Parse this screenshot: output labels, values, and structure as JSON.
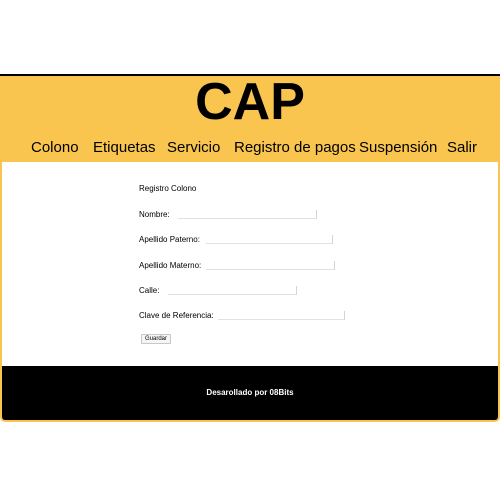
{
  "header": {
    "logo": "CAP",
    "background_color": "#f9c54f"
  },
  "nav": {
    "items": [
      {
        "label": "Colono"
      },
      {
        "label": "Etiquetas"
      },
      {
        "label": "Servicio"
      },
      {
        "label": "Registro de pagos"
      },
      {
        "label": "Suspensión"
      },
      {
        "label": "Salir"
      }
    ]
  },
  "form": {
    "title": "Registro Colono",
    "fields": [
      {
        "label": "Nombre:",
        "value": ""
      },
      {
        "label": "Apellido Paterno:",
        "value": ""
      },
      {
        "label": "Apellido Materno:",
        "value": ""
      },
      {
        "label": "Calle:",
        "value": ""
      },
      {
        "label": "Clave de Referencia:",
        "value": ""
      }
    ],
    "submit_label": "Guardar"
  },
  "footer": {
    "text": "Desarollado por 08Bits",
    "background_color": "#000000"
  }
}
